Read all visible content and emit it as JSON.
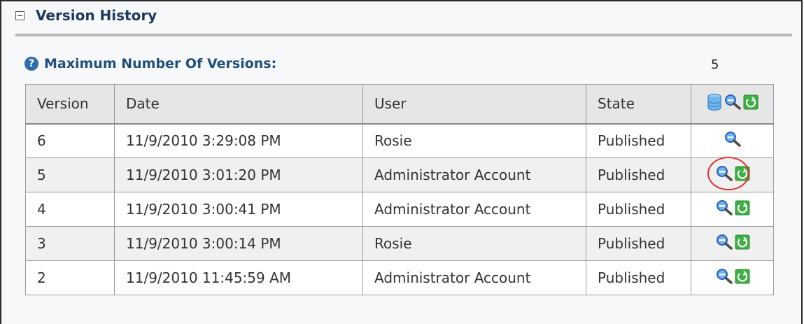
{
  "section": {
    "title": "Version History"
  },
  "settings": {
    "max_versions_label": "Maximum Number Of Versions:",
    "max_versions_value": "5"
  },
  "table": {
    "headers": [
      "Version",
      "Date",
      "User",
      "State"
    ],
    "header_icons": [
      "database-icon",
      "magnifier-icon",
      "restore-icon"
    ],
    "rows": [
      {
        "version": "6",
        "date": "11/9/2010 3:29:08 PM",
        "user": "Rosie",
        "state": "Published",
        "icons": [
          "magnifier-icon"
        ]
      },
      {
        "version": "5",
        "date": "11/9/2010 3:01:20 PM",
        "user": "Administrator Account",
        "state": "Published",
        "icons": [
          "magnifier-icon",
          "restore-icon"
        ],
        "highlighted": true
      },
      {
        "version": "4",
        "date": "11/9/2010 3:00:41 PM",
        "user": "Administrator Account",
        "state": "Published",
        "icons": [
          "magnifier-icon",
          "restore-icon"
        ]
      },
      {
        "version": "3",
        "date": "11/9/2010 3:00:14 PM",
        "user": "Rosie",
        "state": "Published",
        "icons": [
          "magnifier-icon",
          "restore-icon"
        ]
      },
      {
        "version": "2",
        "date": "11/9/2010 11:45:59 AM",
        "user": "Administrator Account",
        "state": "Published",
        "icons": [
          "magnifier-icon",
          "restore-icon"
        ]
      }
    ]
  },
  "colors": {
    "title": "#1f3a5f",
    "label": "#1f4e78",
    "highlight_ring": "#e03030",
    "restore_icon": "#3cb043",
    "magnifier_icon": "#3a7bd5"
  }
}
